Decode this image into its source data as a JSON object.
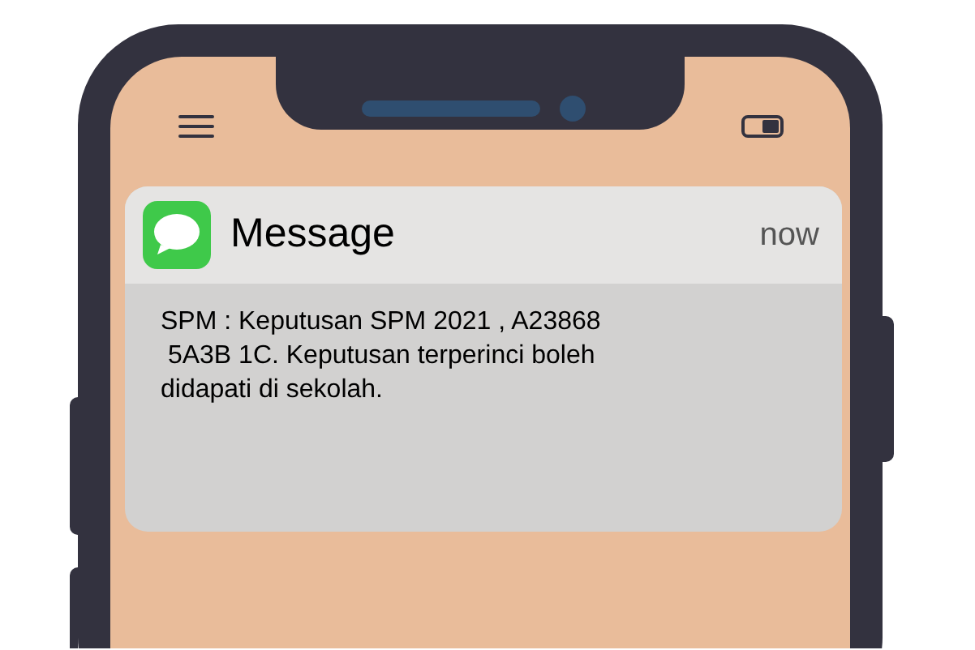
{
  "notification": {
    "app_name": "Message",
    "time": "now",
    "body": "SPM : Keputusan SPM 2021 , A23868\n 5A3B 1C. Keputusan terperinci boleh\ndidapati di sekolah."
  }
}
